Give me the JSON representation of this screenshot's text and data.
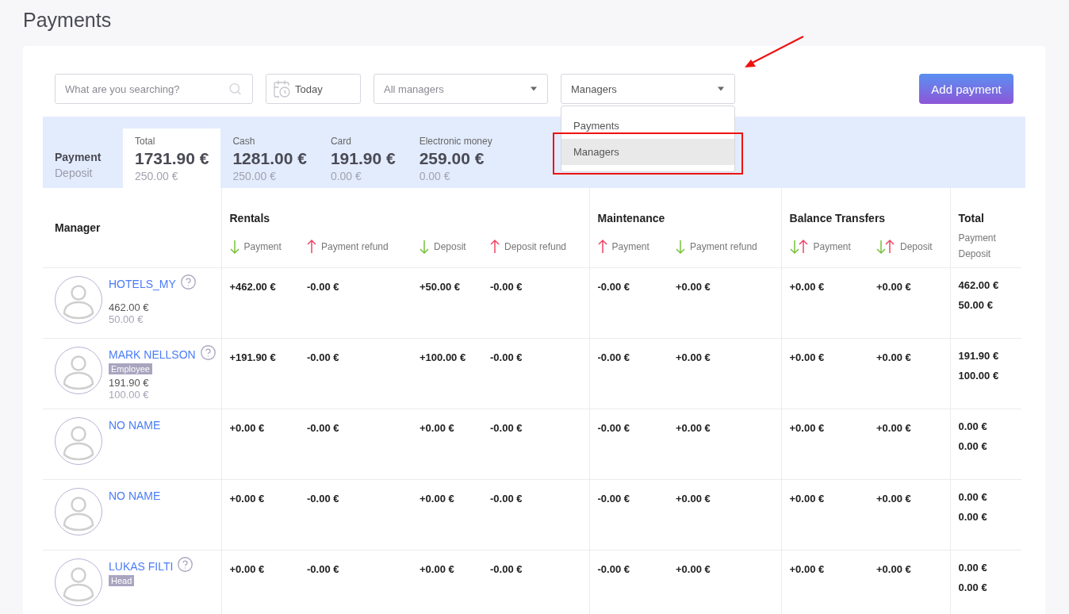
{
  "page_title": "Payments",
  "toolbar": {
    "search": {
      "placeholder": "What are you searching?"
    },
    "date": {
      "value": "Today"
    },
    "manager_filter": {
      "placeholder": "All managers"
    },
    "view_select": {
      "value": "Managers",
      "expanded": true,
      "options": [
        {
          "label": "Payments",
          "selected": false
        },
        {
          "label": "Managers",
          "selected": true
        }
      ]
    },
    "add_button": "Add payment"
  },
  "summary": {
    "row_labels": [
      "Payment",
      "Deposit"
    ],
    "tabs": [
      {
        "label": "Total",
        "payment": "1731.90 €",
        "deposit": "250.00 €",
        "selected": true
      },
      {
        "label": "Cash",
        "payment": "1281.00 €",
        "deposit": "250.00 €",
        "selected": false
      },
      {
        "label": "Card",
        "payment": "191.90 €",
        "deposit": "0.00 €",
        "selected": false
      },
      {
        "label": "Electronic money",
        "payment": "259.00 €",
        "deposit": "0.00 €",
        "selected": false
      }
    ]
  },
  "table": {
    "manager_heading": "Manager",
    "groups": [
      {
        "name": "Rentals",
        "columns": [
          {
            "label": "Payment",
            "kind": "down"
          },
          {
            "label": "Payment refund",
            "kind": "up"
          },
          {
            "label": "Deposit",
            "kind": "down"
          },
          {
            "label": "Deposit refund",
            "kind": "up"
          }
        ]
      },
      {
        "name": "Maintenance",
        "columns": [
          {
            "label": "Payment",
            "kind": "up"
          },
          {
            "label": "Payment refund",
            "kind": "down"
          }
        ]
      },
      {
        "name": "Balance Transfers",
        "columns": [
          {
            "label": "Payment",
            "kind": "both"
          },
          {
            "label": "Deposit",
            "kind": "both"
          }
        ]
      }
    ],
    "total": {
      "heading": "Total",
      "sublabels": [
        "Payment",
        "Deposit"
      ]
    },
    "rows": [
      {
        "name": "HOTELS_MY",
        "help": true,
        "payment": "462.00 €",
        "deposit": "50.00 €",
        "values": [
          "+462.00 €",
          "-0.00 €",
          "+50.00 €",
          "-0.00 €",
          "-0.00 €",
          "+0.00 €",
          "+0.00 €",
          "+0.00 €"
        ],
        "total": [
          "462.00 €",
          "50.00 €"
        ]
      },
      {
        "name": "MARK NELLSON",
        "help": true,
        "role": "Employee",
        "payment": "191.90 €",
        "deposit": "100.00 €",
        "values": [
          "+191.90 €",
          "-0.00 €",
          "+100.00 €",
          "-0.00 €",
          "-0.00 €",
          "+0.00 €",
          "+0.00 €",
          "+0.00 €"
        ],
        "total": [
          "191.90 €",
          "100.00 €"
        ]
      },
      {
        "name": "NO NAME",
        "help": false,
        "values": [
          "+0.00 €",
          "-0.00 €",
          "+0.00 €",
          "-0.00 €",
          "-0.00 €",
          "+0.00 €",
          "+0.00 €",
          "+0.00 €"
        ],
        "total": [
          "0.00 €",
          "0.00 €"
        ]
      },
      {
        "name": "NO NAME",
        "help": false,
        "values": [
          "+0.00 €",
          "-0.00 €",
          "+0.00 €",
          "-0.00 €",
          "-0.00 €",
          "+0.00 €",
          "+0.00 €",
          "+0.00 €"
        ],
        "total": [
          "0.00 €",
          "0.00 €"
        ]
      },
      {
        "name": "LUKAS FILTI",
        "help": true,
        "role": "Head",
        "values": [
          "+0.00 €",
          "-0.00 €",
          "+0.00 €",
          "-0.00 €",
          "-0.00 €",
          "+0.00 €",
          "+0.00 €",
          "+0.00 €"
        ],
        "total": [
          "0.00 €",
          "0.00 €"
        ]
      }
    ]
  }
}
